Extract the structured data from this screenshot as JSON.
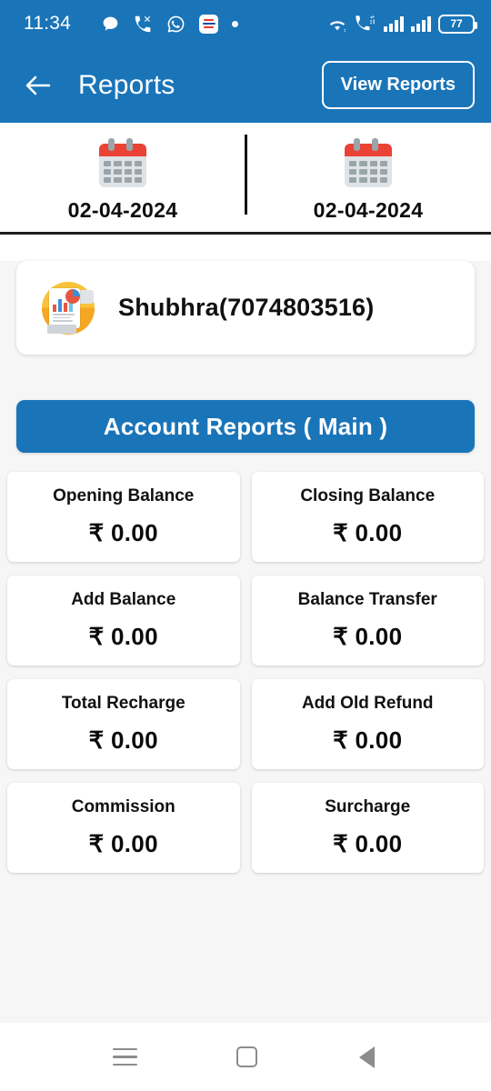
{
  "statusbar": {
    "time": "11:34",
    "battery_level": "77",
    "icons": [
      "message-bubble-icon",
      "missed-call-icon",
      "whatsapp-icon",
      "app-notification-icon",
      "dot-icon"
    ],
    "right_icons": [
      "wifi-icon",
      "wifi-calling-icon",
      "signal-sim1-icon",
      "signal-sim2-icon",
      "battery-icon"
    ]
  },
  "appbar": {
    "back_label": "←",
    "title": "Reports",
    "action_label": "View Reports"
  },
  "date_filter": {
    "from_date": "02-04-2024",
    "to_date": "02-04-2024"
  },
  "user": {
    "name": "Shubhra(7074803516)"
  },
  "section": {
    "title": "Account Reports ( Main )"
  },
  "stats": [
    {
      "label": "Opening Balance",
      "value": "₹ 0.00"
    },
    {
      "label": "Closing Balance",
      "value": "₹ 0.00"
    },
    {
      "label": "Add Balance",
      "value": "₹ 0.00"
    },
    {
      "label": "Balance Transfer",
      "value": "₹ 0.00"
    },
    {
      "label": "Total Recharge",
      "value": "₹ 0.00"
    },
    {
      "label": "Add Old Refund",
      "value": "₹ 0.00"
    },
    {
      "label": "Commission",
      "value": "₹ 0.00"
    },
    {
      "label": "Surcharge",
      "value": "₹ 0.00"
    }
  ],
  "navbar": {
    "recents": "recents-icon",
    "home": "home-icon",
    "back": "back-icon"
  },
  "colors": {
    "primary": "#1a74b8",
    "background": "#f6f6f6",
    "card": "#ffffff",
    "calendar_red": "#ea4335",
    "avatar_yellow": "#f9c23c"
  }
}
